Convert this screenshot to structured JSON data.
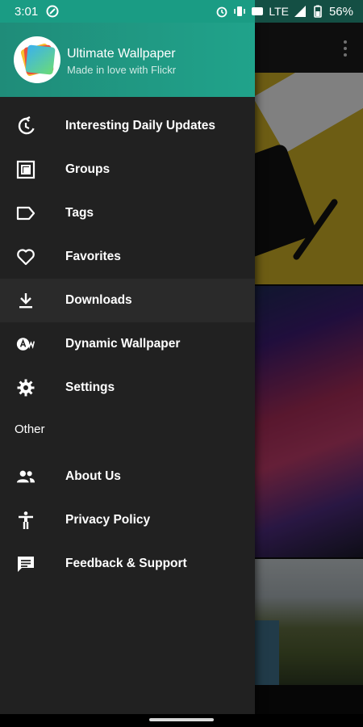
{
  "status_bar": {
    "time": "3:01",
    "network": "LTE",
    "battery": "56%"
  },
  "drawer": {
    "header": {
      "title": "Ultimate Wallpaper",
      "subtitle": "Made in love with Flickr"
    },
    "items": [
      {
        "label": "Interesting Daily Updates",
        "icon": "history-icon"
      },
      {
        "label": "Groups",
        "icon": "groups-icon"
      },
      {
        "label": "Tags",
        "icon": "tag-icon"
      },
      {
        "label": "Favorites",
        "icon": "heart-icon"
      },
      {
        "label": "Downloads",
        "icon": "download-icon"
      },
      {
        "label": "Dynamic Wallpaper",
        "icon": "dynamic-wallpaper-icon"
      },
      {
        "label": "Settings",
        "icon": "gear-icon"
      }
    ],
    "other_section": {
      "title": "Other",
      "items": [
        {
          "label": "About Us",
          "icon": "people-icon"
        },
        {
          "label": "Privacy Policy",
          "icon": "accessibility-icon"
        },
        {
          "label": "Feedback & Support",
          "icon": "feedback-icon"
        }
      ]
    }
  },
  "colors": {
    "header": "#20a38b",
    "drawer_bg": "#212121"
  }
}
